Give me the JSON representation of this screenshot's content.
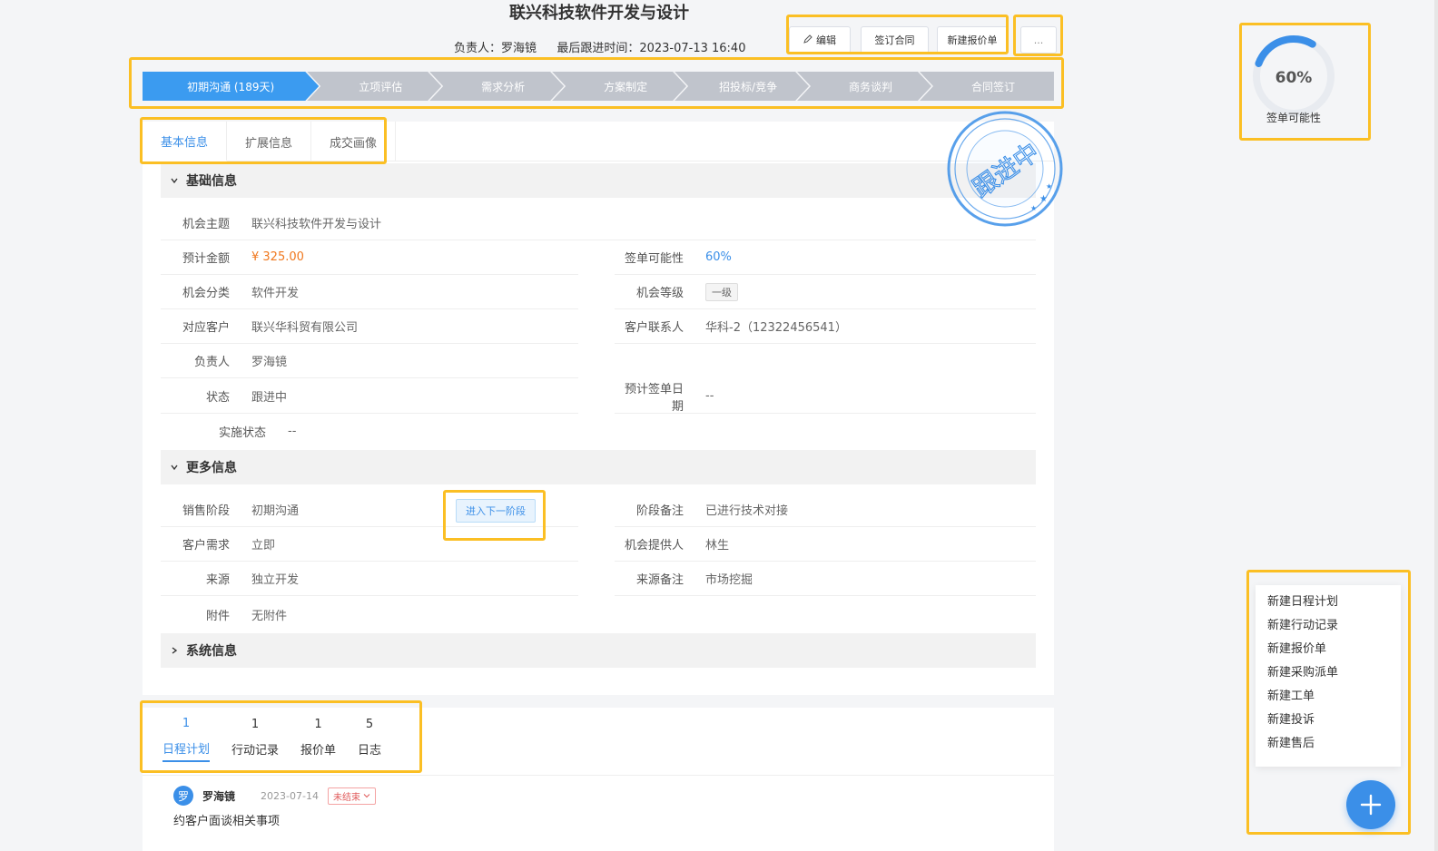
{
  "header": {
    "title": "联兴科技软件开发与设计",
    "owner_label": "负责人：",
    "owner": "罗海镜",
    "last_follow_label": "最后跟进时间：",
    "last_follow": "2023-07-13 16:40"
  },
  "toolbar": {
    "edit": "编辑",
    "sign_contract": "签订合同",
    "new_quote": "新建报价单",
    "more": "..."
  },
  "stages": [
    {
      "label": "初期沟通 (189天)",
      "active": true
    },
    {
      "label": "立项评估"
    },
    {
      "label": "需求分析"
    },
    {
      "label": "方案制定"
    },
    {
      "label": "招投标/竞争"
    },
    {
      "label": "商务谈判"
    },
    {
      "label": "合同签订"
    }
  ],
  "tabs": [
    "基本信息",
    "扩展信息",
    "成交画像"
  ],
  "basic": {
    "section_title": "基础信息",
    "fields": {
      "subject": {
        "label": "机会主题",
        "value": "联兴科技软件开发与设计"
      },
      "amount": {
        "label": "预计金额",
        "value": "¥ 325.00"
      },
      "probability": {
        "label": "签单可能性",
        "value": "60%"
      },
      "category": {
        "label": "机会分类",
        "value": "软件开发"
      },
      "level": {
        "label": "机会等级",
        "value": "一级"
      },
      "customer": {
        "label": "对应客户",
        "value": "联兴华科贸有限公司"
      },
      "contact": {
        "label": "客户联系人",
        "value": "华科-2（12322456541）"
      },
      "owner": {
        "label": "负责人",
        "value": "罗海镜"
      },
      "status": {
        "label": "状态",
        "value": "跟进中"
      },
      "expected_date": {
        "label": "预计签单日期",
        "value": "--"
      },
      "impl_status": {
        "label": "实施状态",
        "value": "--"
      }
    }
  },
  "more": {
    "section_title": "更多信息",
    "next_stage_button": "进入下一阶段",
    "fields": {
      "stage": {
        "label": "销售阶段",
        "value": "初期沟通"
      },
      "stage_note": {
        "label": "阶段备注",
        "value": "已进行技术对接"
      },
      "demand": {
        "label": "客户需求",
        "value": "立即"
      },
      "provider": {
        "label": "机会提供人",
        "value": "林生"
      },
      "source": {
        "label": "来源",
        "value": "独立开发"
      },
      "source_note": {
        "label": "来源备注",
        "value": "市场挖掘"
      },
      "attachment": {
        "label": "附件",
        "value": "无附件"
      }
    }
  },
  "system": {
    "section_title": "系统信息"
  },
  "stamp": {
    "text": "跟进中",
    "color": "#3b8fe8"
  },
  "sub_tabs": [
    {
      "count": "1",
      "label": "日程计划",
      "active": true
    },
    {
      "count": "1",
      "label": "行动记录"
    },
    {
      "count": "1",
      "label": "报价单"
    },
    {
      "count": "5",
      "label": "日志"
    }
  ],
  "record": {
    "avatar": "罗",
    "user": "罗海镜",
    "date": "2023-07-14",
    "status": "未结束",
    "description": "约客户面谈相关事项"
  },
  "gauge": {
    "value_text": "60%",
    "value": 0.6,
    "label": "签单可能性",
    "color": "#3b8fe8"
  },
  "action_menu": [
    "新建日程计划",
    "新建行动记录",
    "新建报价单",
    "新建采购派单",
    "新建工单",
    "新建投诉",
    "新建售后"
  ]
}
